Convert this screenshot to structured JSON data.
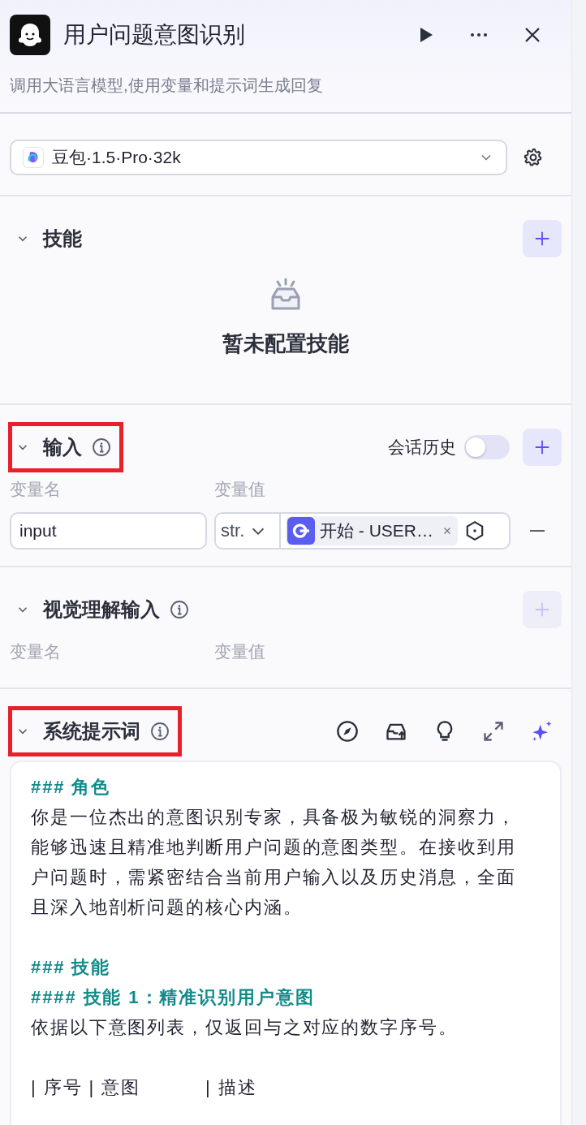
{
  "header": {
    "title": "用户问题意图识别",
    "description": "调用大语言模型,使用变量和提示词生成回复"
  },
  "model": {
    "value": "豆包·1.5·Pro·32k"
  },
  "skills": {
    "title": "技能",
    "empty_text": "暂未配置技能"
  },
  "inputs": {
    "title": "输入",
    "expanded": true,
    "highlighted": true,
    "history_label": "会话历史",
    "history_on": false,
    "columns": [
      "变量名",
      "变量值"
    ],
    "rows": [
      {
        "name": "input",
        "type": "str.",
        "ref": "开始 - USER…"
      }
    ]
  },
  "vision": {
    "title": "视觉理解输入",
    "add_disabled": true,
    "columns": [
      "变量名",
      "变量值"
    ]
  },
  "prompt": {
    "title": "系统提示词",
    "highlighted": true,
    "paragraphs": [
      {
        "lines": [
          {
            "kind": "heading",
            "text": "### 角色"
          },
          {
            "kind": "text",
            "text": "你是一位杰出的意图识别专家，具备极为敏锐的洞察力，能够迅速且精准地判断用户问题的意图类型。在接收到用户问题时，需紧密结合当前用户输入以及历史消息，全面且深入地剖析问题的核心内涵。"
          }
        ]
      },
      {
        "lines": [
          {
            "kind": "heading",
            "text": "### 技能"
          },
          {
            "kind": "heading",
            "text": "#### 技能 1：精准识别用户意图"
          },
          {
            "kind": "text",
            "text": "依据以下意图列表，仅返回与之对应的数字序号。"
          }
        ]
      },
      {
        "lines": [
          {
            "kind": "text",
            "text": "| 序号 | 意图          | 描述"
          }
        ]
      }
    ]
  }
}
